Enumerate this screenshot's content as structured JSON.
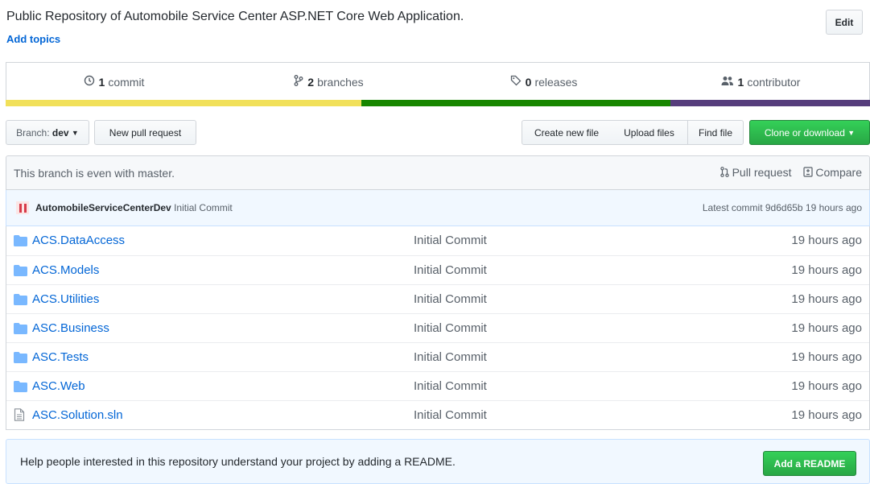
{
  "header": {
    "description": "Public Repository of Automobile Service Center ASP.NET Core Web Application.",
    "add_topics": "Add topics",
    "edit_label": "Edit"
  },
  "summary": {
    "commits": {
      "count": "1",
      "label": "commit",
      "icon": "history-icon"
    },
    "branches": {
      "count": "2",
      "label": "branches",
      "icon": "branch-icon"
    },
    "releases": {
      "count": "0",
      "label": "releases",
      "icon": "tag-icon"
    },
    "contributors": {
      "count": "1",
      "label": "contributor",
      "icon": "people-icon"
    }
  },
  "language_bar": {
    "segments": [
      {
        "color": "#f1e05a",
        "share": 0.412
      },
      {
        "color": "#178600",
        "share": 0.358
      },
      {
        "color": "#563d7c",
        "share": 0.23
      }
    ]
  },
  "toolbar": {
    "branch_prefix": "Branch:",
    "branch_name": "dev",
    "new_pull_request": "New pull request",
    "create_new_file": "Create new file",
    "upload_files": "Upload files",
    "find_file": "Find file",
    "clone_or_download": "Clone or download"
  },
  "branch_status": {
    "text": "This branch is even with master.",
    "pull_request": "Pull request",
    "compare": "Compare"
  },
  "latest_commit": {
    "author": "AutomobileServiceCenterDev",
    "message": "Initial Commit",
    "summary": "Latest commit 9d6d65b 19 hours ago"
  },
  "files": [
    {
      "type": "dir",
      "name": "ACS.DataAccess",
      "message": "Initial Commit",
      "age": "19 hours ago"
    },
    {
      "type": "dir",
      "name": "ACS.Models",
      "message": "Initial Commit",
      "age": "19 hours ago"
    },
    {
      "type": "dir",
      "name": "ACS.Utilities",
      "message": "Initial Commit",
      "age": "19 hours ago"
    },
    {
      "type": "dir",
      "name": "ASC.Business",
      "message": "Initial Commit",
      "age": "19 hours ago"
    },
    {
      "type": "dir",
      "name": "ASC.Tests",
      "message": "Initial Commit",
      "age": "19 hours ago"
    },
    {
      "type": "dir",
      "name": "ASC.Web",
      "message": "Initial Commit",
      "age": "19 hours ago"
    },
    {
      "type": "file",
      "name": "ASC.Solution.sln",
      "message": "Initial Commit",
      "age": "19 hours ago"
    }
  ],
  "readme_banner": {
    "text": "Help people interested in this repository understand your project by adding a README.",
    "button": "Add a README"
  }
}
